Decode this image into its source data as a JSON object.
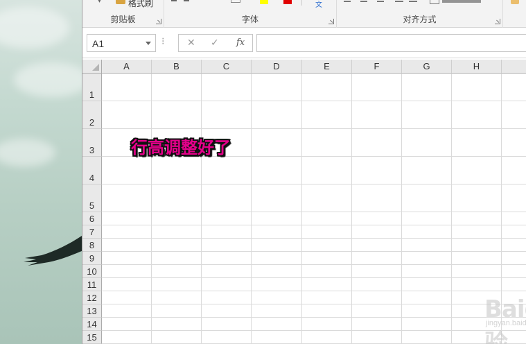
{
  "ribbon": {
    "clipboard": {
      "label": "剪贴板",
      "format_painter": "格式刷"
    },
    "font": {
      "label": "字体"
    },
    "alignment": {
      "label": "对齐方式"
    }
  },
  "formula_bar": {
    "name_box": "A1",
    "cancel_icon": "✕",
    "enter_icon": "✓",
    "fx_label": "fx",
    "formula": ""
  },
  "sheet": {
    "columns": [
      "A",
      "B",
      "C",
      "D",
      "E",
      "F",
      "G",
      "H"
    ],
    "rows": [
      "1",
      "2",
      "3",
      "4",
      "5",
      "6",
      "7",
      "8",
      "9",
      "10",
      "11",
      "12",
      "13",
      "14",
      "15"
    ],
    "cell_B3_text": "行高调整好了"
  },
  "watermark": {
    "logo": "Baidu经验",
    "url": "jingyan.baidu.com"
  },
  "colors": {
    "highlight": "#ffff00",
    "font_color": "#e00000",
    "cell_text": "#e5008a"
  }
}
